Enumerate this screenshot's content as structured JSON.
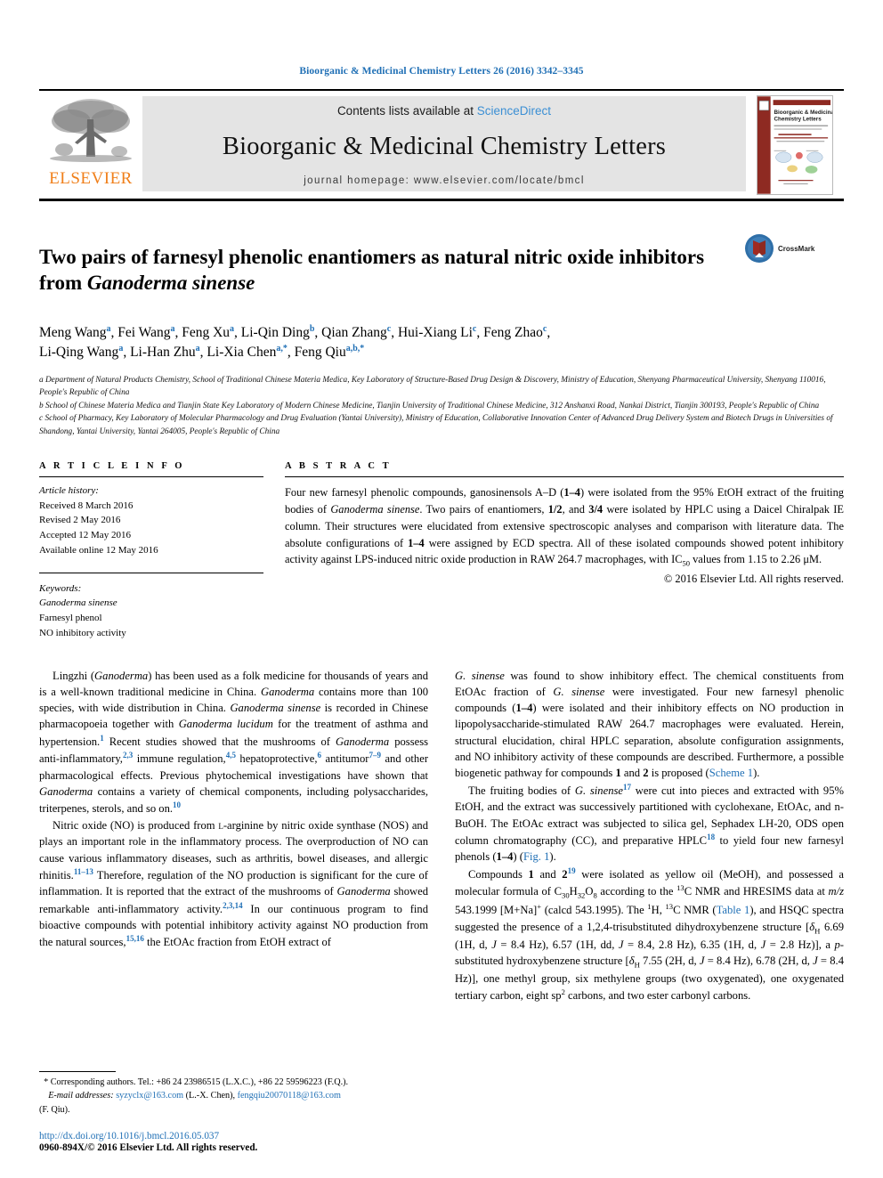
{
  "running_head": "Bioorganic & Medicinal Chemistry Letters 26 (2016) 3342–3345",
  "masthead": {
    "publisher": "ELSEVIER",
    "contents_prefix": "Contents lists available at ",
    "contents_link": "ScienceDirect",
    "journal_title": "Bioorganic & Medicinal Chemistry Letters",
    "homepage": "journal homepage: www.elsevier.com/locate/bmcl",
    "cover_title_line1": "Bioorganic & Medicinal",
    "cover_title_line2": "Chemistry Letters"
  },
  "article": {
    "title_part1": "Two pairs of farnesyl phenolic enantiomers as natural nitric oxide inhibitors from ",
    "title_italic": "Ganoderma sinense",
    "crossmark_label": "CrossMark",
    "authors": "Meng Wang a, Fei Wang a, Feng Xu a, Li-Qin Ding b, Qian Zhang c, Hui-Xiang Li c, Feng Zhao c, Li-Qing Wang a, Li-Han Zhu a, Li-Xia Chen a,*, Feng Qiu a,b,*",
    "affiliations": [
      "a Department of Natural Products Chemistry, School of Traditional Chinese Materia Medica, Key Laboratory of Structure-Based Drug Design & Discovery, Ministry of Education, Shenyang Pharmaceutical University, Shenyang 110016, People's Republic of China",
      "b School of Chinese Materia Medica and Tianjin State Key Laboratory of Modern Chinese Medicine, Tianjin University of Traditional Chinese Medicine, 312 Anshanxi Road, Nankai District, Tianjin 300193, People's Republic of China",
      "c School of Pharmacy, Key Laboratory of Molecular Pharmacology and Drug Evaluation (Yantai University), Ministry of Education, Collaborative Innovation Center of Advanced Drug Delivery System and Biotech Drugs in Universities of Shandong, Yantai University, Yantai 264005, People's Republic of China"
    ]
  },
  "article_info": {
    "heading": "A R T I C L E   I N F O",
    "history_label": "Article history:",
    "history": [
      "Received 8 March 2016",
      "Revised 2 May 2016",
      "Accepted 12 May 2016",
      "Available online 12 May 2016"
    ],
    "keywords_label": "Keywords:",
    "keywords": [
      "Ganoderma sinense",
      "Farnesyl phenol",
      "NO inhibitory activity"
    ]
  },
  "abstract": {
    "heading": "A B S T R A C T",
    "text": "Four new farnesyl phenolic compounds, ganosinensols A–D (1–4) were isolated from the 95% EtOH extract of the fruiting bodies of Ganoderma sinense. Two pairs of enantiomers, 1/2, and 3/4 were isolated by HPLC using a Daicel Chiralpak IE column. Their structures were elucidated from extensive spectroscopic analyses and comparison with literature data. The absolute configurations of 1–4 were assigned by ECD spectra. All of these isolated compounds showed potent inhibitory activity against LPS-induced nitric oxide production in RAW 264.7 macrophages, with IC50 values from 1.15 to 2.26 μM.",
    "copyright": "© 2016 Elsevier Ltd. All rights reserved."
  },
  "body": {
    "left_paragraph_1": "Lingzhi (Ganoderma) has been used as a folk medicine for thousands of years and is a well-known traditional medicine in China. Ganoderma contains more than 100 species, with wide distribution in China. Ganoderma sinense is recorded in Chinese pharmacopoeia together with Ganoderma lucidum for the treatment of asthma and hypertension.1 Recent studies showed that the mushrooms of Ganoderma possess anti-inflammatory,2,3 immune regulation,4,5 hepatoprotective,6 antitumor7–9 and other pharmacological effects. Previous phytochemical investigations have shown that Ganoderma contains a variety of chemical components, including polysaccharides, triterpenes, sterols, and so on.10",
    "left_paragraph_2": "Nitric oxide (NO) is produced from L-arginine by nitric oxide synthase (NOS) and plays an important role in the inflammatory process. The overproduction of NO can cause various inflammatory diseases, such as arthritis, bowel diseases, and allergic rhinitis.11–13 Therefore, regulation of the NO production is significant for the cure of inflammation. It is reported that the extract of the mushrooms of Ganoderma showed remarkable anti-inflammatory activity.2,3,14 In our continuous program to find bioactive compounds with potential inhibitory activity against NO production from the natural sources,15,16 the EtOAc fraction from EtOH extract of",
    "right_paragraph_1": "G. sinense was found to show inhibitory effect. The chemical constituents from EtOAc fraction of G. sinense were investigated. Four new farnesyl phenolic compounds (1–4) were isolated and their inhibitory effects on NO production in lipopolysaccharide-stimulated RAW 264.7 macrophages were evaluated. Herein, structural elucidation, chiral HPLC separation, absolute configuration assignments, and NO inhibitory activity of these compounds are described. Furthermore, a possible biogenetic pathway for compounds 1 and 2 is proposed (Scheme 1).",
    "right_paragraph_2": "The fruiting bodies of G. sinense17 were cut into pieces and extracted with 95% EtOH, and the extract was successively partitioned with cyclohexane, EtOAc, and n-BuOH. The EtOAc extract was subjected to silica gel, Sephadex LH-20, ODS open column chromatography (CC), and preparative HPLC18 to yield four new farnesyl phenols (1–4) (Fig. 1).",
    "right_paragraph_3": "Compounds 1 and 219 were isolated as yellow oil (MeOH), and possessed a molecular formula of C30H32O8 according to the 13C NMR and HRESIMS data at m/z 543.1999 [M+Na]+ (calcd 543.1995). The 1H, 13C NMR (Table 1), and HSQC spectra suggested the presence of a 1,2,4-trisubstituted dihydroxybenzene structure [δH 6.69 (1H, d, J = 8.4 Hz), 6.57 (1H, dd, J = 8.4, 2.8 Hz), 6.35 (1H, d, J = 2.8 Hz)], a p-substituted hydroxybenzene structure [δH 7.55 (2H, d, J = 8.4 Hz), 6.78 (2H, d, J = 8.4 Hz)], one methyl group, six methylene groups (two oxygenated), one oxygenated tertiary carbon, eight sp2 carbons, and two ester carbonyl carbons."
  },
  "footnotes": {
    "corresponding": "* Corresponding authors. Tel.: +86 24 23986515 (L.X.C.), +86 22 59596223 (F.Q.).",
    "email_label": "E-mail addresses:",
    "email1": "syzyclx@163.com",
    "email1_owner": "(L.-X. Chen),",
    "email2": "fengqiu20070118@163.com",
    "email2_owner": "(F. Qiu).",
    "doi": "http://dx.doi.org/10.1016/j.bmcl.2016.05.037",
    "issn": "0960-894X/© 2016 Elsevier Ltd. All rights reserved."
  },
  "colors": {
    "link_blue": "#1f6fb5",
    "sciencedirect_blue": "#3b8fd4",
    "elsevier_orange": "#f07f1a",
    "cover_maroon": "#8e2a22",
    "masthead_grey": "#e4e4e4"
  }
}
